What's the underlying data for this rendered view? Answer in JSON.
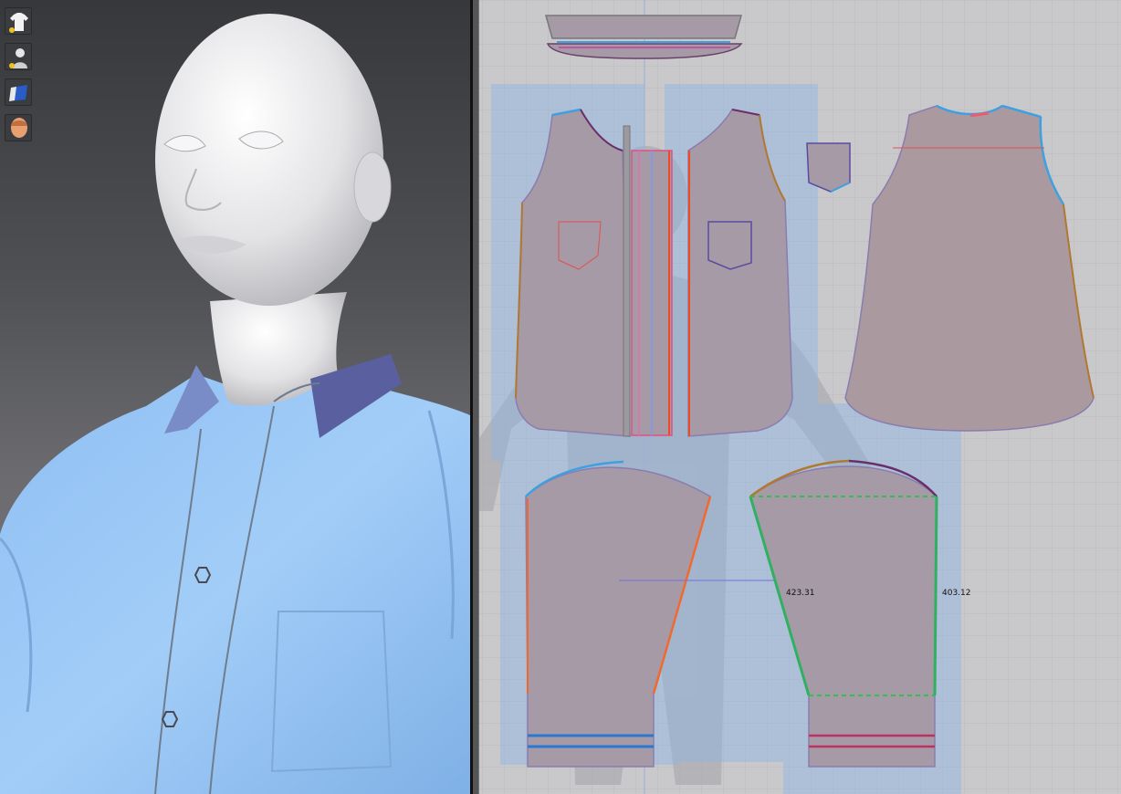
{
  "toolbar": {
    "items": [
      {
        "icon": "garment-shirt-icon",
        "tooltip": ""
      },
      {
        "icon": "avatar-icon",
        "tooltip": ""
      },
      {
        "icon": "texture-fabric-icon",
        "tooltip": ""
      },
      {
        "icon": "avatar-head-icon",
        "tooltip": ""
      }
    ]
  },
  "viewport3d": {
    "shirt_color": "#9cc8f5",
    "collar_color": "#5a5fa0",
    "avatar_color": "#e8e8ea"
  },
  "pattern2d": {
    "pattern_fill": "#a69aa6",
    "grid_color": "#bfbfc2",
    "selection_color": "#8cb6e6",
    "measurements": {
      "sleeve_seam_left": "423.31",
      "sleeve_seam_right": "403.12"
    }
  }
}
